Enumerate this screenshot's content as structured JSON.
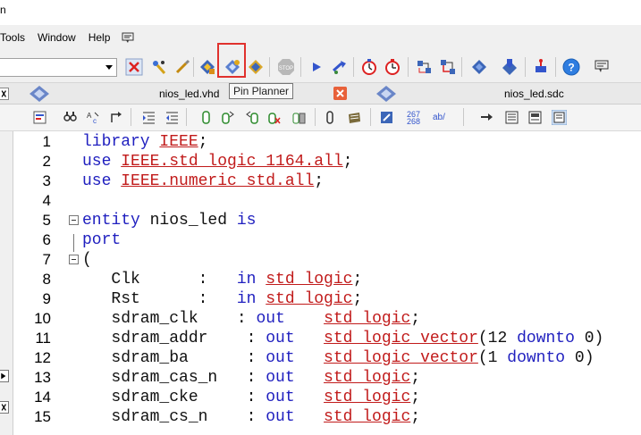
{
  "window": {
    "title_fragment": "n"
  },
  "menubar": {
    "items": [
      "Tools",
      "Window",
      "Help"
    ]
  },
  "toolbar": {
    "icons": [
      "stop-compilation-icon",
      "analysis-icon",
      "compile-icon",
      "chip-planner-icon",
      "pin-planner-icon",
      "assignment-editor-icon",
      "stop-icon",
      "start-icon",
      "run-icon",
      "timing-icon",
      "timing-analyzer-icon",
      "netlist-viewer-icon",
      "rtl-viewer-icon",
      "programmer-icon",
      "signaltap-icon",
      "chip-icon",
      "help-icon",
      "whats-this-icon"
    ]
  },
  "tabs": [
    {
      "label": "nios_led.vhd"
    },
    {
      "label": "nios_led.sdc"
    }
  ],
  "tooltip": {
    "text": "Pin Planner"
  },
  "editor_toolbar": {
    "line_counter_top": "267",
    "line_counter_bottom": "268",
    "ab_label": "ab/"
  },
  "code": {
    "lines": [
      {
        "n": "1",
        "segs": [
          [
            "kw",
            "library "
          ],
          [
            "ty",
            "IEEE"
          ],
          [
            "tx",
            ";"
          ]
        ]
      },
      {
        "n": "2",
        "segs": [
          [
            "kw",
            "use "
          ],
          [
            "ty",
            "IEEE.std_logic_1164.all"
          ],
          [
            "tx",
            ";"
          ]
        ]
      },
      {
        "n": "3",
        "segs": [
          [
            "kw",
            "use "
          ],
          [
            "ty",
            "IEEE.numeric_std.all"
          ],
          [
            "tx",
            ";"
          ]
        ]
      },
      {
        "n": "4",
        "segs": []
      },
      {
        "n": "5",
        "segs": [
          [
            "kw",
            "entity "
          ],
          [
            "tx",
            "nios_led "
          ],
          [
            "kw",
            "is"
          ]
        ]
      },
      {
        "n": "6",
        "segs": [
          [
            "kw",
            "port"
          ]
        ]
      },
      {
        "n": "7",
        "segs": [
          [
            "tx",
            "("
          ]
        ]
      },
      {
        "n": "8",
        "segs": [
          [
            "tx",
            "   Clk      :   "
          ],
          [
            "kw",
            "in "
          ],
          [
            "ty",
            "std_logic"
          ],
          [
            "tx",
            ";"
          ]
        ]
      },
      {
        "n": "9",
        "segs": [
          [
            "tx",
            "   Rst      :   "
          ],
          [
            "kw",
            "in "
          ],
          [
            "ty",
            "std_logic"
          ],
          [
            "tx",
            ";"
          ]
        ]
      },
      {
        "n": "10",
        "segs": [
          [
            "tx",
            "   sdram_clk    : "
          ],
          [
            "kw",
            "out"
          ],
          [
            "tx",
            "    "
          ],
          [
            "ty",
            "std_logic"
          ],
          [
            "tx",
            ";"
          ]
        ]
      },
      {
        "n": "11",
        "segs": [
          [
            "tx",
            "   sdram_addr    : "
          ],
          [
            "kw",
            "out"
          ],
          [
            "tx",
            "   "
          ],
          [
            "ty",
            "std_logic_vector"
          ],
          [
            "tx",
            "(12 "
          ],
          [
            "kw",
            "downto"
          ],
          [
            "tx",
            " 0)"
          ]
        ]
      },
      {
        "n": "12",
        "segs": [
          [
            "tx",
            "   sdram_ba      : "
          ],
          [
            "kw",
            "out"
          ],
          [
            "tx",
            "   "
          ],
          [
            "ty",
            "std_logic_vector"
          ],
          [
            "tx",
            "(1 "
          ],
          [
            "kw",
            "downto"
          ],
          [
            "tx",
            " 0)"
          ]
        ]
      },
      {
        "n": "13",
        "segs": [
          [
            "tx",
            "   sdram_cas_n   : "
          ],
          [
            "kw",
            "out"
          ],
          [
            "tx",
            "   "
          ],
          [
            "ty",
            "std_logic"
          ],
          [
            "tx",
            ";"
          ]
        ]
      },
      {
        "n": "14",
        "segs": [
          [
            "tx",
            "   sdram_cke     : "
          ],
          [
            "kw",
            "out"
          ],
          [
            "tx",
            "   "
          ],
          [
            "ty",
            "std_logic"
          ],
          [
            "tx",
            ";"
          ]
        ]
      },
      {
        "n": "15",
        "segs": [
          [
            "tx",
            "   sdram_cs_n    : "
          ],
          [
            "kw",
            "out"
          ],
          [
            "tx",
            "   "
          ],
          [
            "ty",
            "std_logic"
          ],
          [
            "tx",
            ";"
          ]
        ]
      }
    ]
  }
}
